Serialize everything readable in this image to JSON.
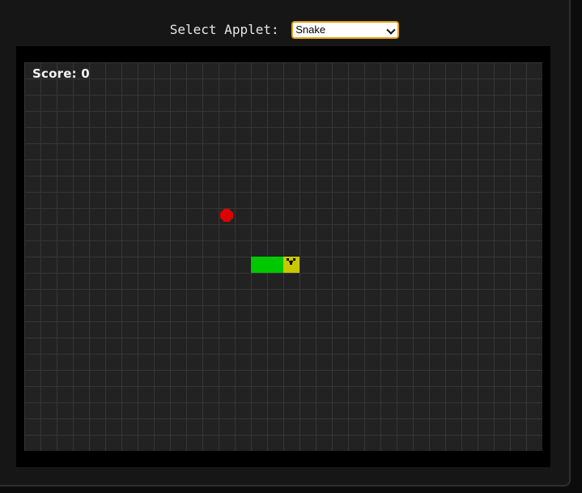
{
  "header": {
    "select_label": "Select Applet:",
    "applet_select": {
      "value": "Snake"
    }
  },
  "game": {
    "score_text": "Score: 0",
    "grid": {
      "cols": 32,
      "rows": 24
    },
    "food": {
      "col": 12,
      "row": 9,
      "color": "#dd0000"
    },
    "snake": {
      "body": [
        {
          "col": 14,
          "row": 12
        },
        {
          "col": 15,
          "row": 12
        },
        {
          "col": 16,
          "row": 12
        }
      ],
      "head": {
        "col": 16,
        "row": 12
      },
      "body_color": "#00c800",
      "head_color": "#c8c800"
    }
  }
}
